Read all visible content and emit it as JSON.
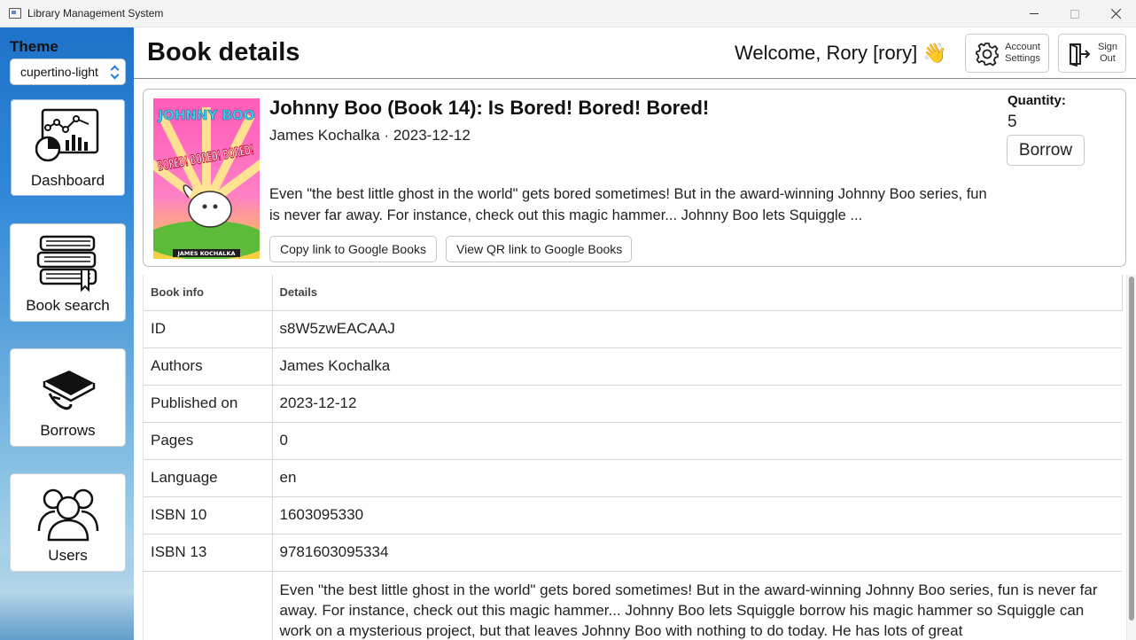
{
  "window": {
    "title": "Library Management System"
  },
  "sidebar": {
    "theme_label": "Theme",
    "theme_value": "cupertino-light",
    "items": [
      {
        "label": "Dashboard",
        "icon": "dashboard-icon",
        "active": true
      },
      {
        "label": "Book search",
        "icon": "books-stack-icon",
        "active": false
      },
      {
        "label": "Borrows",
        "icon": "borrow-book-icon",
        "active": false
      },
      {
        "label": "Users",
        "icon": "users-icon",
        "active": false
      }
    ]
  },
  "header": {
    "page_title": "Book details",
    "welcome": "Welcome, Rory [rory] 👋",
    "account_settings": "Account Settings",
    "sign_out": "Sign Out"
  },
  "book": {
    "title": "Johnny Boo (Book 14): Is Bored! Bored! Bored!",
    "meta": "James Kochalka · 2023-12-12",
    "description_short": "Even \"the best little ghost in the world\" gets bored sometimes! But in the award-winning Johnny Boo series, fun is never far away. For instance, check out this magic hammer... Johnny Boo lets Squiggle ...",
    "copy_link_label": "Copy link to Google Books",
    "qr_link_label": "View QR link to Google Books",
    "quantity_label": "Quantity:",
    "quantity": "5",
    "borrow_label": "Borrow",
    "cover": {
      "top_text": "JOHNNY BOO",
      "mid_text": "BORED! BORED! BORED!",
      "author_text": "JAMES KOCHALKA"
    }
  },
  "table": {
    "headers": [
      "Book info",
      "Details"
    ],
    "rows": [
      {
        "label": "ID",
        "value": "s8W5zwEACAAJ"
      },
      {
        "label": "Authors",
        "value": "James Kochalka"
      },
      {
        "label": "Published on",
        "value": "2023-12-12"
      },
      {
        "label": "Pages",
        "value": "0"
      },
      {
        "label": "Language",
        "value": "en"
      },
      {
        "label": "ISBN 10",
        "value": "1603095330"
      },
      {
        "label": "ISBN 13",
        "value": "9781603095334"
      },
      {
        "label": "",
        "value": "Even \"the best little ghost in the world\" gets bored sometimes! But in the award-winning Johnny Boo series, fun is never far away. For instance, check out this magic hammer... Johnny Boo lets Squiggle borrow his magic hammer so Squiggle can work on a mysterious project, but that leaves Johnny Boo with nothing to do today. He has lots of great"
      }
    ]
  }
}
